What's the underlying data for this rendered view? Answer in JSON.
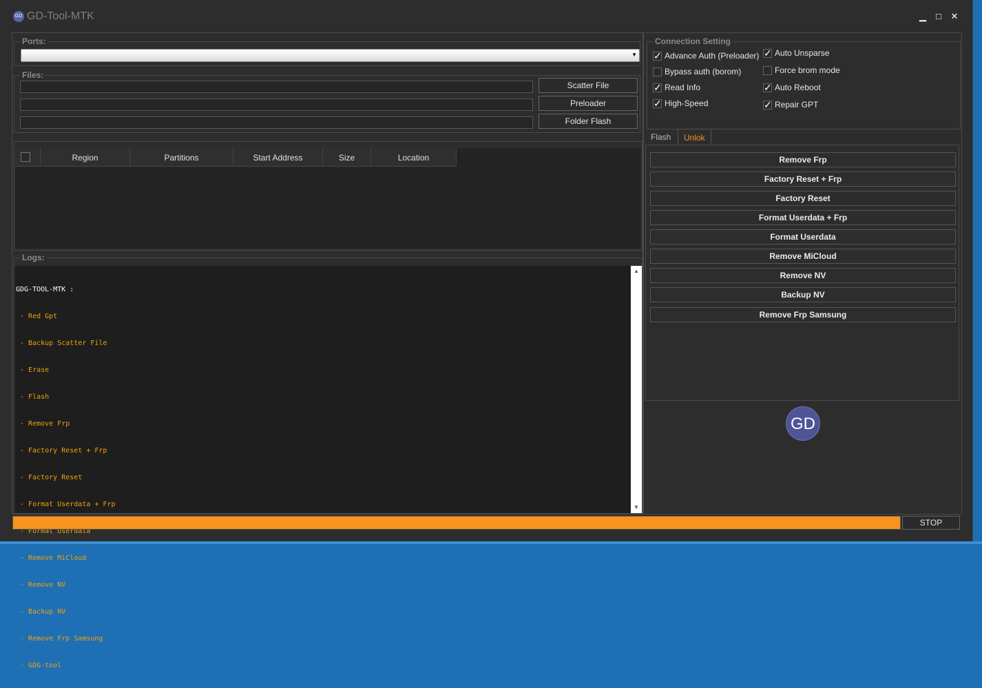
{
  "app": {
    "title": "GD-Tool-MTK",
    "logo_text": "GD"
  },
  "window_controls": {
    "minimize": "▁",
    "maximize": "□",
    "close": "✕"
  },
  "ports": {
    "title": "Ports:",
    "selected": ""
  },
  "files": {
    "title": "Files:",
    "rows": [
      {
        "value": "",
        "button": "Scatter File"
      },
      {
        "value": "",
        "button": "Preloader"
      },
      {
        "value": "",
        "button": "Folder Flash"
      }
    ]
  },
  "partitions_table": {
    "columns": [
      "Region",
      "Partitions",
      "Start Address",
      "Size",
      "Location"
    ],
    "rows": []
  },
  "logs": {
    "title": "Logs:",
    "header": "GDG-TOOL-MTK :",
    "items": [
      " - Red Gpt",
      " - Backup Scatter File",
      " - Erase",
      " - Flash",
      " - Remove Frp",
      " - Factory Reset + Frp",
      " - Factory Reset",
      " - Format Userdata + Frp",
      " - Format Userdata",
      " - Remove MiCloud",
      " - Remove NV",
      " - Backup NV",
      " - Remove Frp Samsung",
      " - GDG-tool"
    ]
  },
  "connection": {
    "title": "Connection Setting",
    "options": [
      {
        "label": "Advance Auth (Preloader)",
        "checked": true
      },
      {
        "label": "Bypass auth (borom)",
        "checked": false
      },
      {
        "label": "Read Info",
        "checked": true
      },
      {
        "label": "High-Speed",
        "checked": true
      },
      {
        "label": "Auto Unsparse",
        "checked": true
      },
      {
        "label": "Force brom mode",
        "checked": false
      },
      {
        "label": "Auto Reboot",
        "checked": true
      },
      {
        "label": "Repair GPT",
        "checked": true
      }
    ]
  },
  "tabs": [
    {
      "label": "Flash",
      "active": false
    },
    {
      "label": "Unlok",
      "active": true
    }
  ],
  "unlock_actions": [
    "Remove Frp",
    "Factory Reset + Frp",
    "Factory Reset",
    "Format Userdata + Frp",
    "Format Userdata",
    "Remove MiCloud",
    "Remove NV",
    "Backup NV",
    "Remove Frp Samsung"
  ],
  "progress": {
    "fraction": 1.0,
    "color": "#f7931e"
  },
  "stop_label": "STOP",
  "colors": {
    "accent": "#f7931e",
    "log_text": "#f0a30a",
    "background": "#2d2d2d"
  }
}
